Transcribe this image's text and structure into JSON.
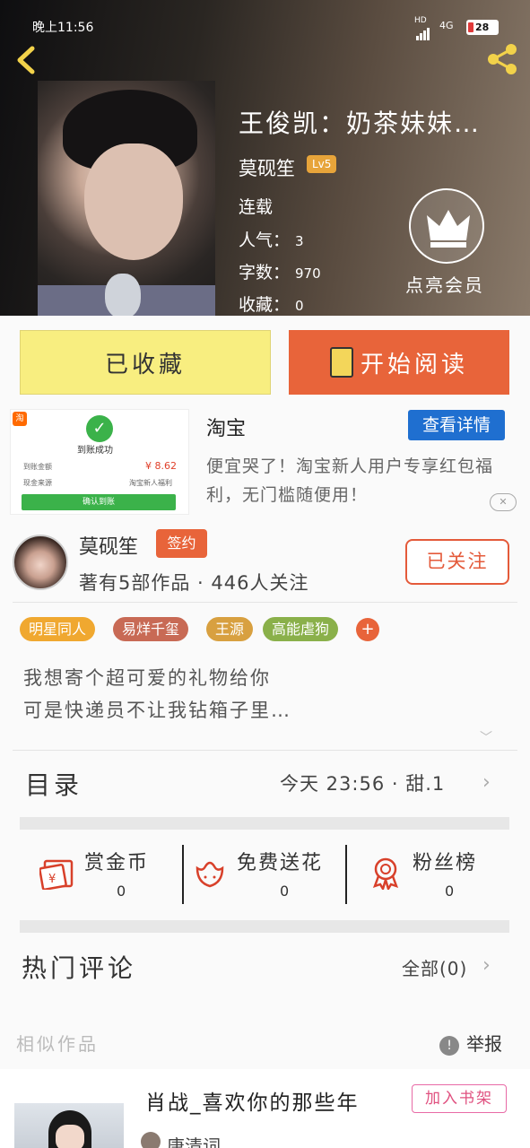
{
  "status_bar": {
    "time": "晚上11:56",
    "network": "4G",
    "signal_label": "HD",
    "battery": "28"
  },
  "book": {
    "title": "王俊凯：奶茶妹妹…",
    "author": "莫砚笙",
    "level": "Lv5",
    "status": "连载",
    "popularity_label": "人气：",
    "popularity": "3",
    "words_label": "字数：",
    "words": "970",
    "favorites_label": "收藏：",
    "favorites": "0"
  },
  "member": {
    "label": "点亮会员"
  },
  "actions": {
    "collected_label": "已收藏",
    "read_label": "开始阅读"
  },
  "ad": {
    "name": "淘宝",
    "detail_label": "查看详情",
    "description": "便宜哭了！淘宝新人用户专享红包福利，无门槛随便用！",
    "close_label": "✕",
    "image": {
      "logo": "淘",
      "success_text": "到账成功",
      "amount_label": "到账金额",
      "amount": "¥ 8.62",
      "source_label": "现金来源",
      "source": "淘宝新人福利",
      "confirm_label": "确认到账"
    }
  },
  "author": {
    "name": "莫砚笙",
    "badge": "签约",
    "stats": "著有5部作品 · 446人关注",
    "follow_label": "已关注"
  },
  "tags": [
    {
      "label": "明星同人",
      "color": "#f0a830"
    },
    {
      "label": "易烊千玺",
      "color": "#c86a55"
    },
    {
      "label": "王源",
      "color": "#d8a040"
    },
    {
      "label": "高能虐狗",
      "color": "#8ab04a"
    }
  ],
  "tag_more": "+",
  "intro": {
    "line1": "我想寄个超可爱的礼物给你",
    "line2": "可是快递员不让我钻箱子里…"
  },
  "toc": {
    "label": "目录",
    "latest": "今天 23:56 · 甜.1"
  },
  "interactions": [
    {
      "label": "赏金币",
      "count": "0",
      "icon": "red-envelope-icon"
    },
    {
      "label": "免费送花",
      "count": "0",
      "icon": "flower-icon"
    },
    {
      "label": "粉丝榜",
      "count": "0",
      "icon": "medal-icon"
    }
  ],
  "comments": {
    "label": "热门评论",
    "all_label": "全部(0)"
  },
  "similar": {
    "label": "相似作品",
    "report_label": "举报"
  },
  "recommendation": {
    "title": "肖战_喜欢你的那些年",
    "shelf_label": "加入书架",
    "author": "唐清词"
  },
  "colors": {
    "accent_orange": "#e8643a",
    "accent_yellow": "#f8ee80",
    "ad_blue": "#1f6fd0"
  }
}
